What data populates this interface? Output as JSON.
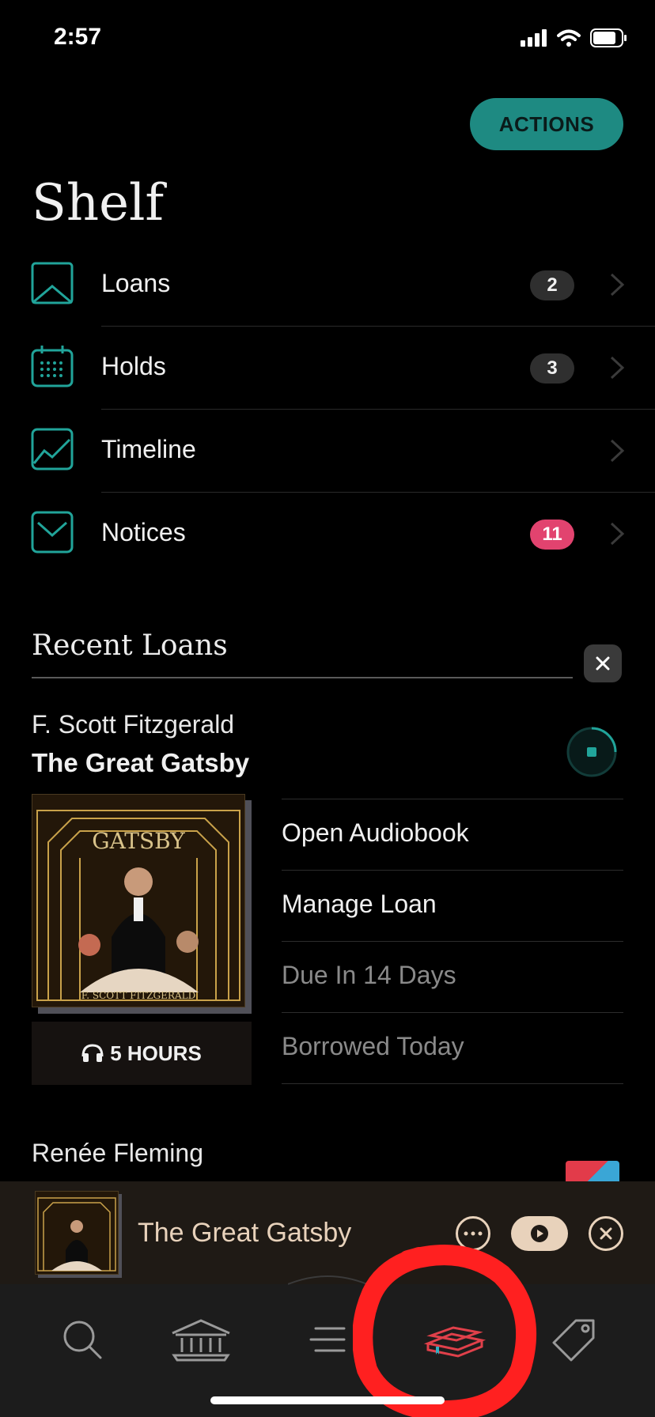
{
  "status_bar": {
    "time": "2:57"
  },
  "header": {
    "actions_label": "ACTIONS",
    "title": "Shelf"
  },
  "nav": [
    {
      "label": "Loans",
      "badge": "2"
    },
    {
      "label": "Holds",
      "badge": "3"
    },
    {
      "label": "Timeline",
      "badge": ""
    },
    {
      "label": "Notices",
      "badge": "11"
    }
  ],
  "recent_loans": {
    "title": "Recent Loans",
    "items": [
      {
        "author": "F. Scott Fitzgerald",
        "title": "The Great Gatsby",
        "duration": "5 HOURS",
        "cover_text": "GATSBY",
        "cover_author": "F. SCOTT FITZGERALD",
        "menu": [
          "Open Audiobook",
          "Manage Loan",
          "Due In 14 Days",
          "Borrowed Today"
        ]
      },
      {
        "author": "Renée Fleming"
      }
    ]
  },
  "mini_player": {
    "title": "The Great Gatsby"
  },
  "colors": {
    "accent": "#1e8a82",
    "notice_badge": "#e2436f",
    "player_tint": "#e8d2bb",
    "annotation": "#ff2020"
  }
}
